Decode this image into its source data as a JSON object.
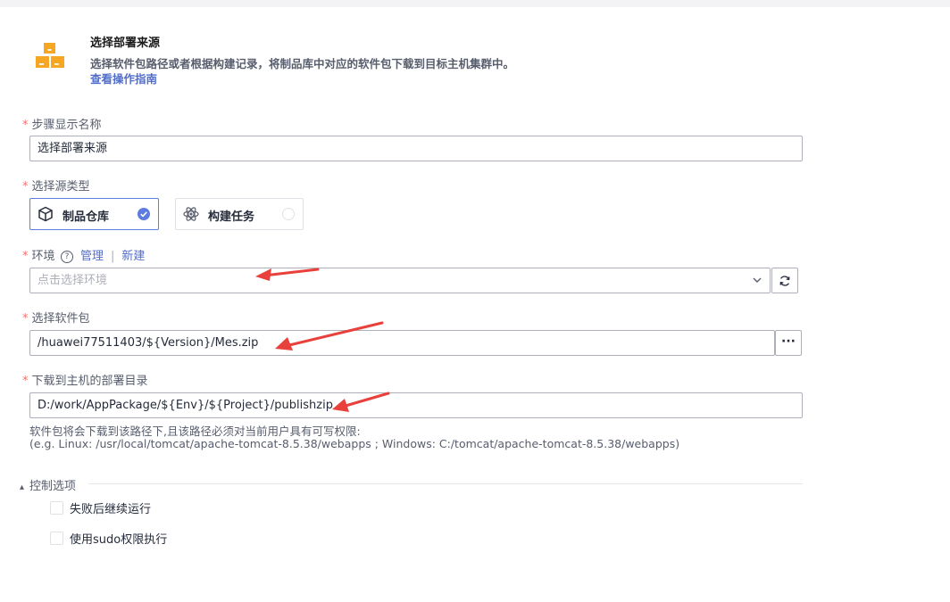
{
  "header": {
    "title": "选择部署来源",
    "description": "选择软件包路径或者根据构建记录，将制品库中对应的软件包下载到目标主机集群中。",
    "guide_link": "查看操作指南",
    "icon": "boxes-icon",
    "accent_color": "#f5a623"
  },
  "step_name": {
    "required_mark": "*",
    "label": "步骤显示名称",
    "value": "选择部署来源"
  },
  "source_type": {
    "required_mark": "*",
    "label": "选择源类型",
    "options": [
      {
        "label": "制品仓库",
        "icon": "cube-icon",
        "selected": true
      },
      {
        "label": "构建任务",
        "icon": "atom-icon",
        "selected": false
      }
    ],
    "selected_color": "#5e7ce0"
  },
  "environment": {
    "required_mark": "*",
    "label": "环境",
    "help_icon": "?",
    "manage_link": "管理",
    "separator": "|",
    "new_link": "新建",
    "placeholder": "点击选择环境"
  },
  "package": {
    "required_mark": "*",
    "label": "选择软件包",
    "value": "/huawei77511403/${Version}/Mes.zip",
    "more_button": "···"
  },
  "deploy_dir": {
    "required_mark": "*",
    "label": "下载到主机的部署目录",
    "value": "D:/work/AppPackage/${Env}/${Project}/publishzip",
    "hint_line1": "软件包将会下载到该路径下,且该路径必须对当前用户具有可写权限:",
    "hint_line2": "(e.g. Linux: /usr/local/tomcat/apache-tomcat-8.5.38/webapps ; Windows: C:/tomcat/apache-tomcat-8.5.38/webapps)"
  },
  "control_options": {
    "toggle_icon": "▴",
    "title": "控制选项",
    "options": [
      {
        "label": "失败后继续运行",
        "checked": false
      },
      {
        "label": "使用sudo权限执行",
        "checked": false
      }
    ]
  },
  "annotation_color": "#e8413b"
}
